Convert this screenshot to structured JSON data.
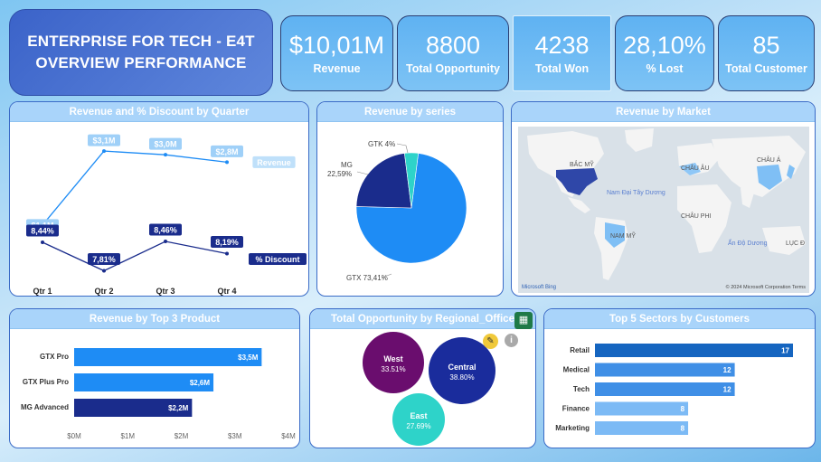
{
  "header": {
    "line1": "ENTERPRISE FOR TECH - E4T",
    "line2": "OVERVIEW PERFORMANCE"
  },
  "kpis": [
    {
      "value": "$10,01M",
      "label": "Revenue"
    },
    {
      "value": "8800",
      "label": "Total Opportunity"
    },
    {
      "value": "4238",
      "label": "Total Won"
    },
    {
      "value": "28,10%",
      "label": "% Lost"
    },
    {
      "value": "85",
      "label": "Total Customer"
    }
  ],
  "panels": {
    "quarter": {
      "title": "Revenue and % Discount by Quarter"
    },
    "series": {
      "title": "Revenue by series"
    },
    "market": {
      "title": "Revenue by Market"
    },
    "product": {
      "title": "Revenue by Top 3 Product"
    },
    "regional": {
      "title": "Total Opportunity by Regional_Office"
    },
    "sectors": {
      "title": "Top 5 Sectors by Customers"
    }
  },
  "colors": {
    "accent": "#1e8cf5",
    "navy": "#1a2c8c",
    "light": "#6fb4f5",
    "header": "#a9d4fa",
    "teal": "#2ed3c9",
    "purple": "#6a0d6e"
  },
  "map": {
    "labels": [
      "BẮC MỸ",
      "CHÂU ÂU",
      "CHÂU Á",
      "CHÂU PHI",
      "NAM MỸ",
      "LỤC Đ"
    ],
    "oceans": [
      "Nam Đại Tây Dương",
      "Ấn Độ Dương"
    ],
    "attribution_left": "Microsoft Bing",
    "attribution_right": "© 2024 Microsoft Corporation  Terms"
  },
  "icons": {
    "grid": "table-icon",
    "pen": "pencil-icon",
    "info": "info-icon"
  },
  "chart_data": [
    {
      "type": "line",
      "title": "Revenue and % Discount by Quarter",
      "categories": [
        "Qtr 1",
        "Qtr 2",
        "Qtr 3",
        "Qtr 4"
      ],
      "series": [
        {
          "name": "Revenue",
          "values": [
            1.1,
            3.1,
            3.0,
            2.8
          ],
          "labels": [
            "$1,1M",
            "$3,1M",
            "$3,0M",
            "$2,8M"
          ],
          "color": "#1e8cf5"
        },
        {
          "name": "% Discount",
          "values": [
            8.44,
            7.81,
            8.46,
            8.19
          ],
          "labels": [
            "8,44%",
            "7,81%",
            "8,46%",
            "8,19%"
          ],
          "color": "#1a2c8c"
        }
      ]
    },
    {
      "type": "pie",
      "title": "Revenue by series",
      "slices": [
        {
          "name": "GTX",
          "value": 73.41,
          "label": "GTX 73,41%",
          "color": "#1e8cf5"
        },
        {
          "name": "MG",
          "value": 22.59,
          "label": "22,59%",
          "color": "#1a2c8c"
        },
        {
          "name": "GTK",
          "value": 4.0,
          "label": "GTK 4%",
          "color": "#2ed3c9"
        }
      ]
    },
    {
      "type": "bar",
      "title": "Revenue by Top 3 Product",
      "categories": [
        "GTX Pro",
        "GTX Plus Pro",
        "MG Advanced"
      ],
      "values": [
        3.5,
        2.6,
        2.2
      ],
      "labels": [
        "$3,5M",
        "$2,6M",
        "$2,2M"
      ],
      "colors": [
        "#1e8cf5",
        "#1e8cf5",
        "#1a2c8c"
      ],
      "ticks": [
        "$0M",
        "$1M",
        "$2M",
        "$3M",
        "$4M"
      ],
      "xlim": [
        0,
        4
      ]
    },
    {
      "type": "scatter",
      "title": "Total Opportunity by Regional_Office",
      "bubbles": [
        {
          "name": "West",
          "value": "33.51%",
          "color": "#6a0d6e"
        },
        {
          "name": "Central",
          "value": "38.80%",
          "color": "#1a2c9c"
        },
        {
          "name": "East",
          "value": "27.69%",
          "color": "#2ed3c9"
        }
      ]
    },
    {
      "type": "bar",
      "title": "Top 5 Sectors by Customers",
      "categories": [
        "Retail",
        "Medical",
        "Tech",
        "Finance",
        "Marketing"
      ],
      "values": [
        17,
        12,
        12,
        8,
        8
      ],
      "colors": [
        "#1565c0",
        "#3f8fe6",
        "#3f8fe6",
        "#7cbaf5",
        "#7cbaf5"
      ],
      "xlim": [
        0,
        17
      ]
    }
  ]
}
